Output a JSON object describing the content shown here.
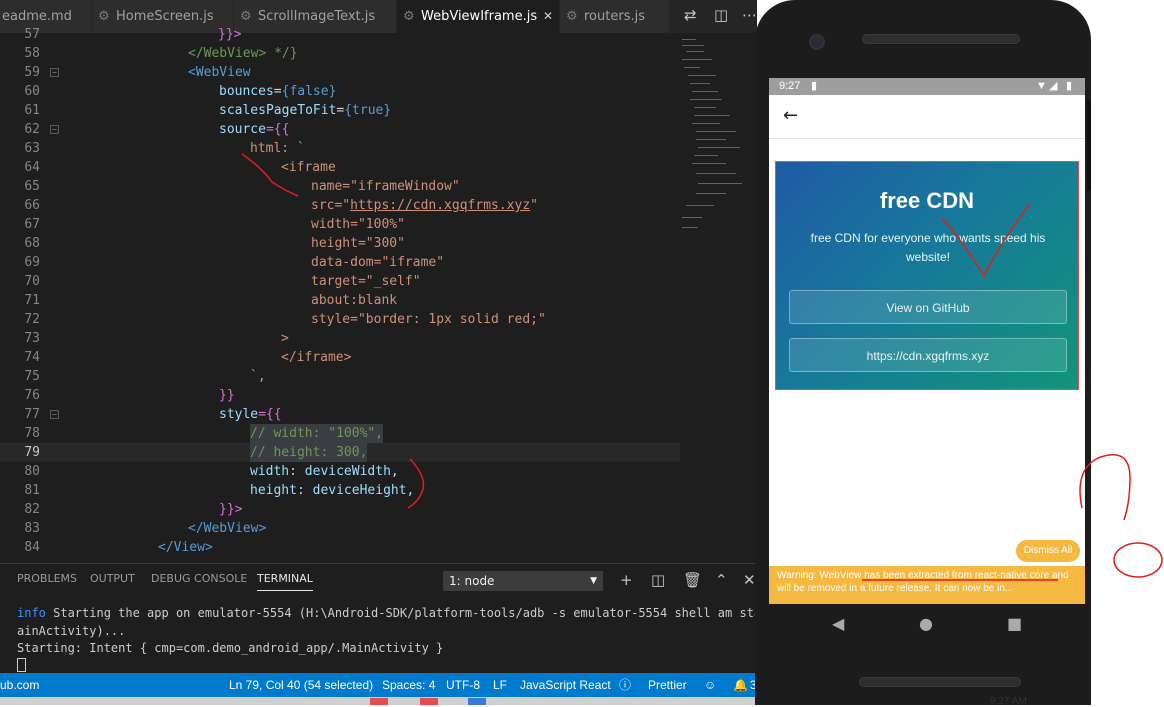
{
  "tabs": [
    {
      "label": "eadme.md",
      "icon": "info-icon"
    },
    {
      "label": "HomeScreen.js",
      "icon": "gear-icon"
    },
    {
      "label": "ScrollImageText.js",
      "icon": "gear-icon"
    },
    {
      "label": "WebViewIframe.js",
      "icon": "gear-icon",
      "active": true,
      "close": "✕"
    },
    {
      "label": "routers.js",
      "icon": "gear-icon"
    }
  ],
  "code": {
    "line_numbers": [
      "57",
      "58",
      "59",
      "60",
      "61",
      "62",
      "63",
      "64",
      "65",
      "66",
      "67",
      "68",
      "69",
      "70",
      "71",
      "72",
      "73",
      "74",
      "75",
      "76",
      "77",
      "78",
      "79",
      "80",
      "81",
      "82",
      "83",
      "84"
    ],
    "l57": "}}>",
    "l58": "</WebView> */}",
    "l59_tag": "<WebView",
    "l60_attr": "bounces",
    "l60_val": "{false}",
    "l61_attr": "scalesPageToFit",
    "l61_val": "{true}",
    "l62_attr": "source",
    "l62_val": "={{",
    "l63": "html: `",
    "l64": "<iframe",
    "l65": "name=\"iframeWindow\"",
    "l66_a": "src=\"",
    "l66_url": "https://cdn.xgqfrms.xyz",
    "l66_b": "\"",
    "l67": "width=\"100%\"",
    "l68": "height=\"300\"",
    "l69": "data-dom=\"iframe\"",
    "l70": "target=\"_self\"",
    "l71": "about:blank",
    "l72": "style=\"border: 1px solid red;\"",
    "l73": ">",
    "l74": "</iframe>",
    "l75": "`,",
    "l76": "}}",
    "l77_attr": "style",
    "l77_val": "={{",
    "l78": "// width: \"100%\",",
    "l79": "// height: 300,",
    "l80_k": "width:",
    "l80_v": "deviceWidth,",
    "l81_k": "height:",
    "l81_v": "deviceHeight,",
    "l82": "}}>",
    "l83": "</WebView>",
    "l84": "</View>"
  },
  "panel": {
    "tabs": [
      "PROBLEMS",
      "OUTPUT",
      "DEBUG CONSOLE",
      "TERMINAL"
    ],
    "terminal_select": "1: node",
    "lines": [
      {
        "prefix": "info",
        "text": " Starting the app on emulator-5554 (H:\\Android-SDK/platform-tools/adb -s emulator-5554 shell am start"
      },
      {
        "prefix": "",
        "text": "ainActivity)..."
      },
      {
        "prefix": "",
        "text": "Starting: Intent { cmp=com.demo_android_app/.MainActivity }"
      }
    ]
  },
  "statusbar": {
    "left": "ub.com",
    "position": "Ln 79, Col 40 (54 selected)",
    "spaces": "Spaces: 4",
    "encoding": "UTF-8",
    "eol": "LF",
    "language": "JavaScript React",
    "formatter": "Prettier",
    "partial": "3"
  },
  "phone": {
    "time": "9:27",
    "cdn_title": "free CDN",
    "cdn_desc": "free CDN for everyone who wants speed his website!",
    "btn_github": "View on GitHub",
    "btn_url": "https://cdn.xgqfrms.xyz",
    "dismiss": "Dismiss All",
    "warning": "Warning: WebView has been extracted from react-native core and will be removed in a future release. It can now be in..."
  },
  "clock": "9:27 AM",
  "colors": {
    "accent": "#007acc",
    "warning": "#f5b942",
    "annotation": "#e11d1d"
  }
}
